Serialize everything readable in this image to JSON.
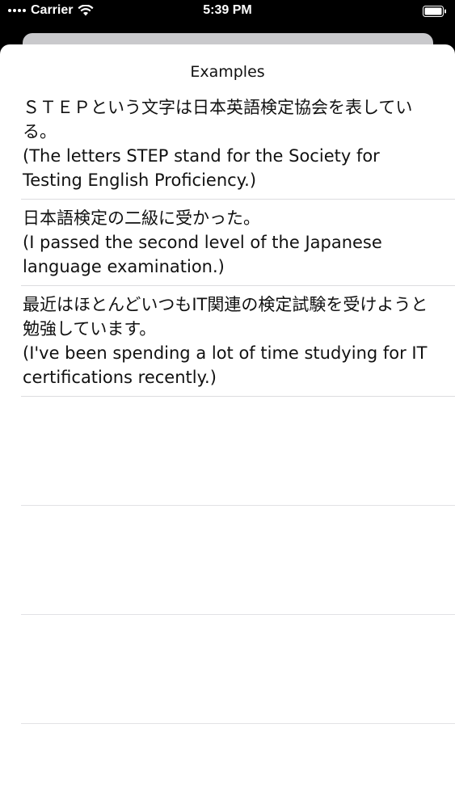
{
  "status_bar": {
    "carrier": "Carrier",
    "time": "5:39 PM"
  },
  "sheet": {
    "title": "Examples"
  },
  "examples": [
    {
      "japanese": "ＳＴＥＰという文字は日本英語検定協会を表している。",
      "english": "(The letters STEP stand for the Society for Testing English Proficiency.)"
    },
    {
      "japanese": "日本語検定の二級に受かった。",
      "english": "(I passed the second level of the Japanese language examination.)"
    },
    {
      "japanese": "最近はほとんどいつもIT関連の検定試験を受けようと勉強しています。",
      "english": "(I've been spending a lot of time studying for IT certifications recently.)"
    }
  ],
  "icons": {
    "wifi": "wifi-icon",
    "battery": "battery-icon"
  },
  "colors": {
    "sheet_background": "#ffffff",
    "backdrop": "#000000",
    "separator": "#dcdcdf"
  }
}
